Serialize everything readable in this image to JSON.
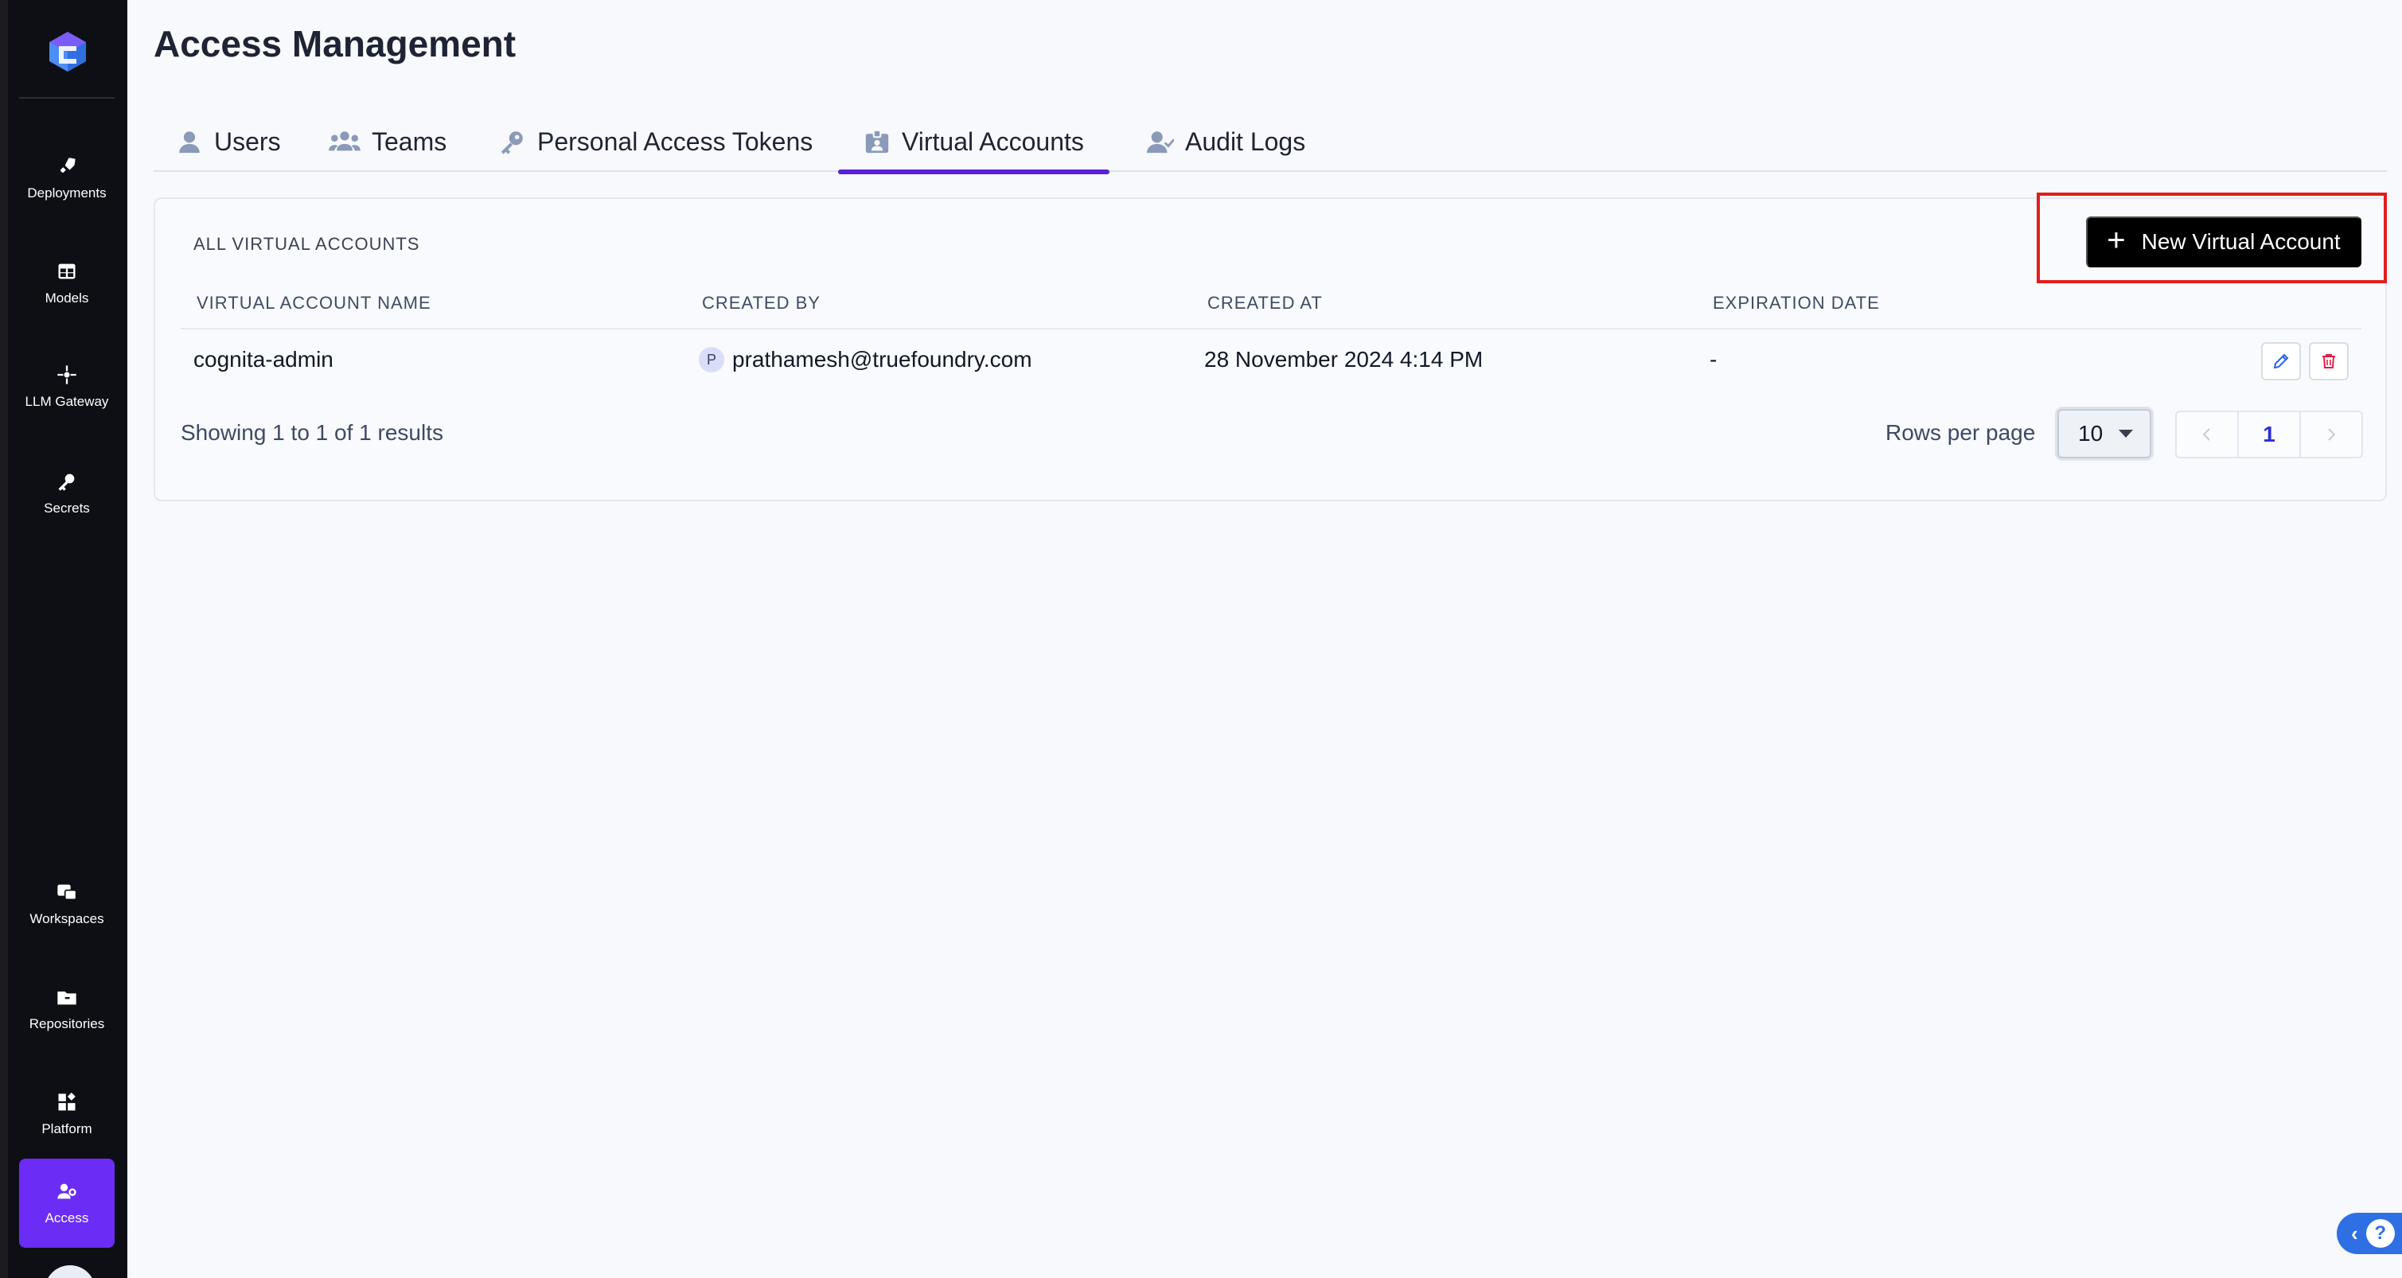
{
  "page": {
    "title": "Access Management"
  },
  "sidebar": {
    "items": [
      {
        "label": "Deployments",
        "icon": "rocket-icon"
      },
      {
        "label": "Models",
        "icon": "models-grid-icon"
      },
      {
        "label": "LLM Gateway",
        "icon": "gateway-icon"
      },
      {
        "label": "Secrets",
        "icon": "key-icon"
      },
      {
        "label": "Workspaces",
        "icon": "workspaces-icon"
      },
      {
        "label": "Repositories",
        "icon": "repository-folder-icon"
      },
      {
        "label": "Platform",
        "icon": "platform-grid-icon"
      },
      {
        "label": "Access",
        "icon": "access-user-key-icon",
        "active": true
      }
    ],
    "active_color": "#6b2cf5"
  },
  "tabs": [
    {
      "label": "Users",
      "icon": "user-icon"
    },
    {
      "label": "Teams",
      "icon": "team-icon"
    },
    {
      "label": "Personal Access Tokens",
      "icon": "key-icon"
    },
    {
      "label": "Virtual Accounts",
      "icon": "id-badge-icon",
      "active": true
    },
    {
      "label": "Audit Logs",
      "icon": "user-check-icon"
    }
  ],
  "card": {
    "title": "ALL VIRTUAL ACCOUNTS",
    "new_button_label": "New Virtual Account",
    "columns": [
      "VIRTUAL ACCOUNT NAME",
      "CREATED BY",
      "CREATED AT",
      "EXPIRATION DATE"
    ],
    "rows": [
      {
        "name": "cognita-admin",
        "created_by_initial": "P",
        "created_by": "prathamesh@truefoundry.com",
        "created_at": "28 November 2024 4:14 PM",
        "expiration": "-"
      }
    ],
    "results_text": "Showing 1 to 1 of 1 results",
    "rows_per_page_label": "Rows per page",
    "rows_per_page_value": "10",
    "current_page": "1"
  },
  "colors": {
    "accent": "#5b21d6",
    "highlight": "#e11d1d",
    "delete": "#e11d48",
    "edit": "#2563eb"
  }
}
